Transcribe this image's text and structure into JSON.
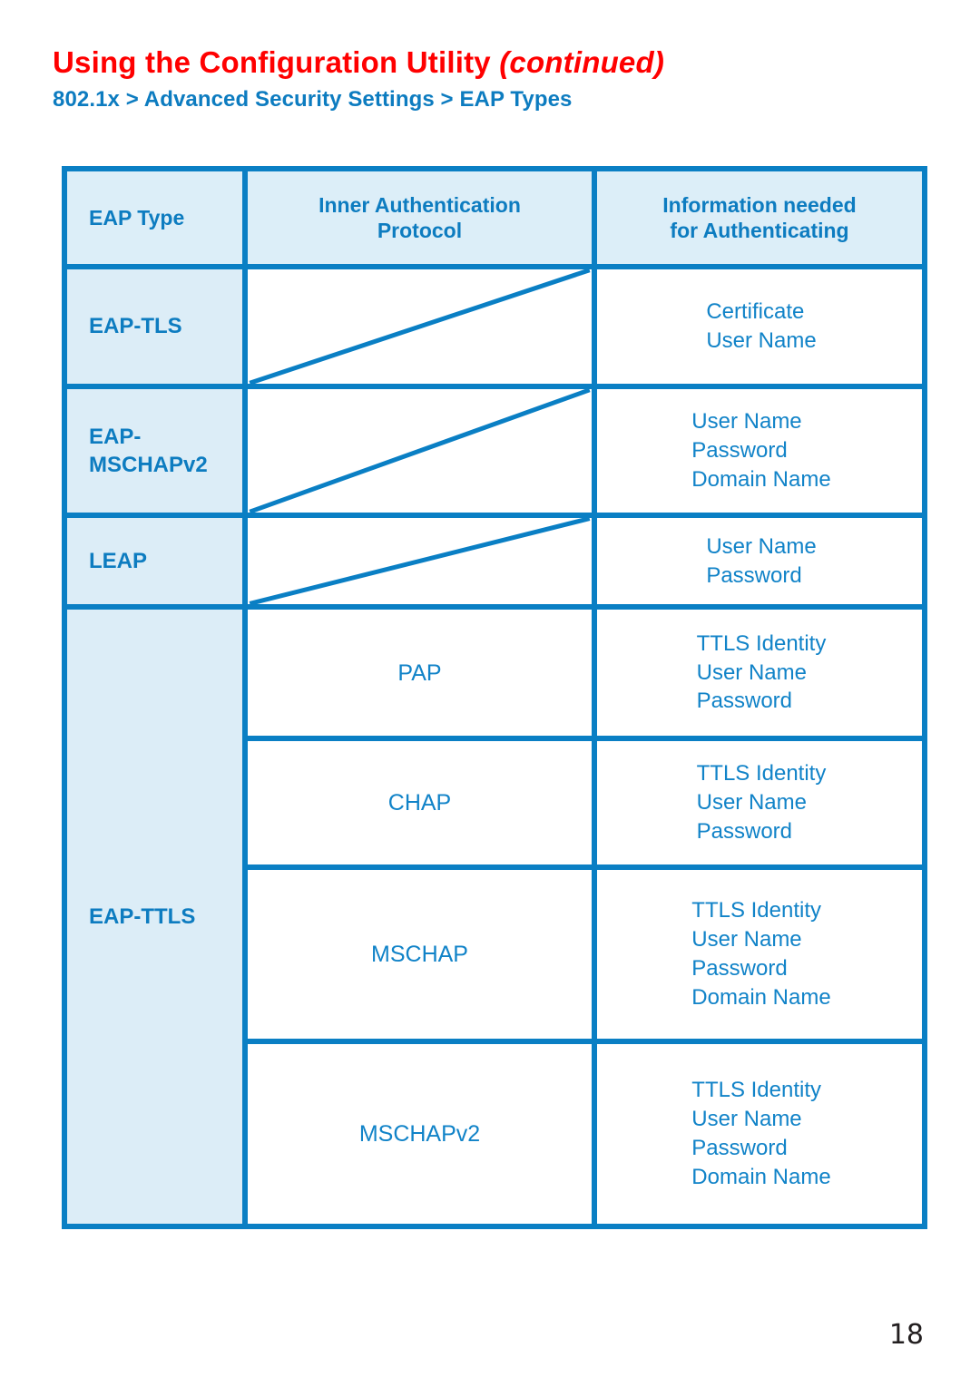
{
  "header": {
    "title_main": "Using the Configuration Utility ",
    "title_continued": "(continued)",
    "subtitle": "802.1x > Advanced Security Settings > EAP Types"
  },
  "table": {
    "columns": [
      "EAP Type",
      "Inner Authentication Protocol",
      "Information needed for Authenticating"
    ],
    "column_headers": {
      "eap_type": "EAP Type",
      "inner_auth_line1": "Inner Authentication",
      "inner_auth_line2": "Protocol",
      "info_line1": "Information needed",
      "info_line2": "for Authenticating"
    },
    "rows": [
      {
        "eap_type": "EAP-TLS",
        "eap_type_line1": "EAP-TLS",
        "eap_type_line2": "",
        "inner_protocol": "",
        "inner_protocol_is_slash": true,
        "info": [
          "Certificate",
          "User Name"
        ]
      },
      {
        "eap_type": "EAP-MSCHAPv2",
        "eap_type_line1": "EAP-",
        "eap_type_line2": "MSCHAPv2",
        "inner_protocol": "",
        "inner_protocol_is_slash": true,
        "info": [
          "User Name",
          "Password",
          "Domain Name"
        ]
      },
      {
        "eap_type": "LEAP",
        "eap_type_line1": "LEAP",
        "eap_type_line2": "",
        "inner_protocol": "",
        "inner_protocol_is_slash": true,
        "info": [
          "User Name",
          "Password"
        ]
      },
      {
        "eap_type": "EAP-TTLS",
        "eap_type_line1": "EAP-TTLS",
        "eap_type_line2": "",
        "inner_protocol": "PAP",
        "inner_protocol_is_slash": false,
        "info": [
          "TTLS Identity",
          "User Name",
          "Password"
        ]
      },
      {
        "eap_type": "EAP-TTLS",
        "eap_type_line1": "",
        "eap_type_line2": "",
        "inner_protocol": "CHAP",
        "inner_protocol_is_slash": false,
        "info": [
          "TTLS Identity",
          "User Name",
          "Password"
        ]
      },
      {
        "eap_type": "EAP-TTLS",
        "eap_type_line1": "",
        "eap_type_line2": "",
        "inner_protocol": "MSCHAP",
        "inner_protocol_is_slash": false,
        "info": [
          "TTLS Identity",
          "User Name",
          "Password",
          "Domain Name"
        ]
      },
      {
        "eap_type": "EAP-TTLS",
        "eap_type_line1": "",
        "eap_type_line2": "",
        "inner_protocol": "MSCHAPv2",
        "inner_protocol_is_slash": false,
        "info": [
          "TTLS Identity",
          "User Name",
          "Password",
          "Domain Name"
        ]
      }
    ],
    "eap_ttls_label": "EAP-TTLS"
  },
  "footer": {
    "page_number": "18"
  },
  "colors": {
    "title_red": "#ff0000",
    "brand_blue": "#0d7cc0",
    "border_blue": "#0a7fc4",
    "header_bg": "#dceef8",
    "label_col_bg": "#dcedf7",
    "body_text_blue": "#1183c8",
    "page_number": "#231f20"
  }
}
